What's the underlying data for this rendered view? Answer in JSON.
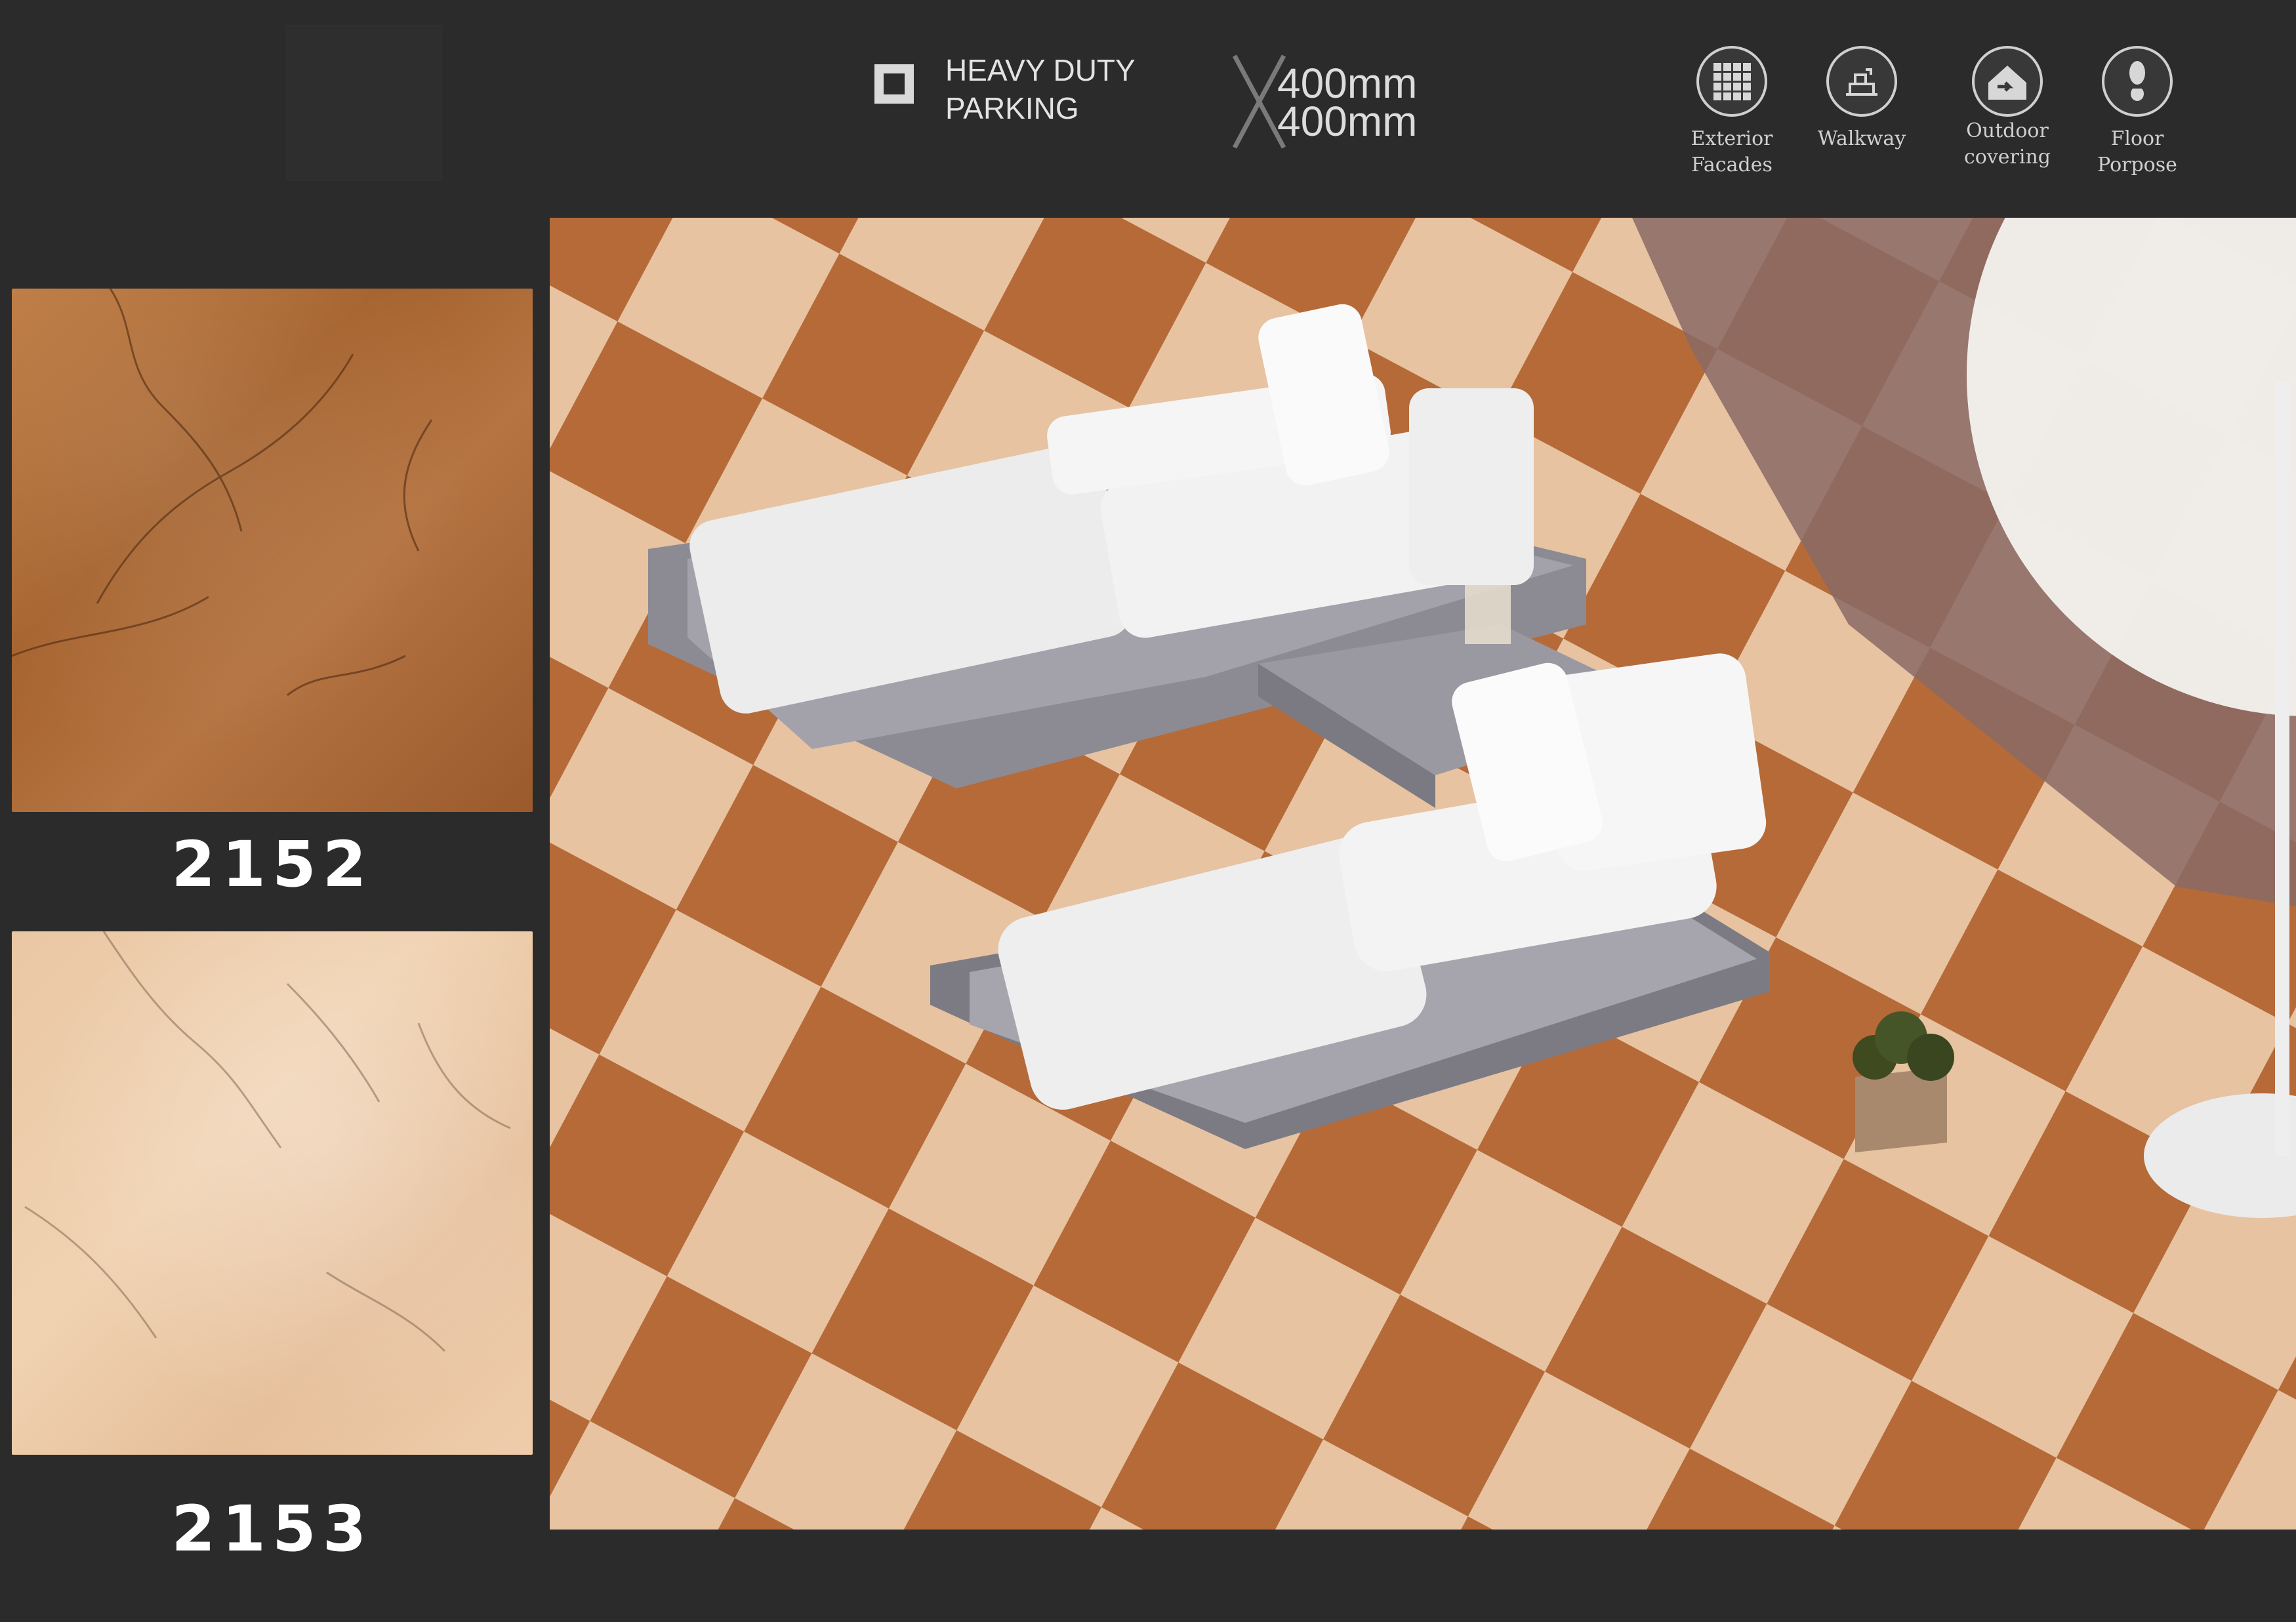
{
  "header": {
    "badge": {
      "line1": "HEAVY DUTY",
      "line2": "PARKING"
    },
    "size": {
      "line1": "400mm",
      "line2": "400mm"
    },
    "uses": [
      {
        "label": "Exterior\nFacades",
        "icon": "grid-tile-icon"
      },
      {
        "label": "Walkway",
        "icon": "walkway-icon"
      },
      {
        "label": "Outdoor\ncovering",
        "icon": "outdoor-house-icon"
      },
      {
        "label": "Floor\nPorpose",
        "icon": "footprint-icon"
      }
    ]
  },
  "products": [
    {
      "code": "2152",
      "color": "#ad6b36"
    },
    {
      "code": "2153",
      "color": "#ecc9a6"
    }
  ]
}
